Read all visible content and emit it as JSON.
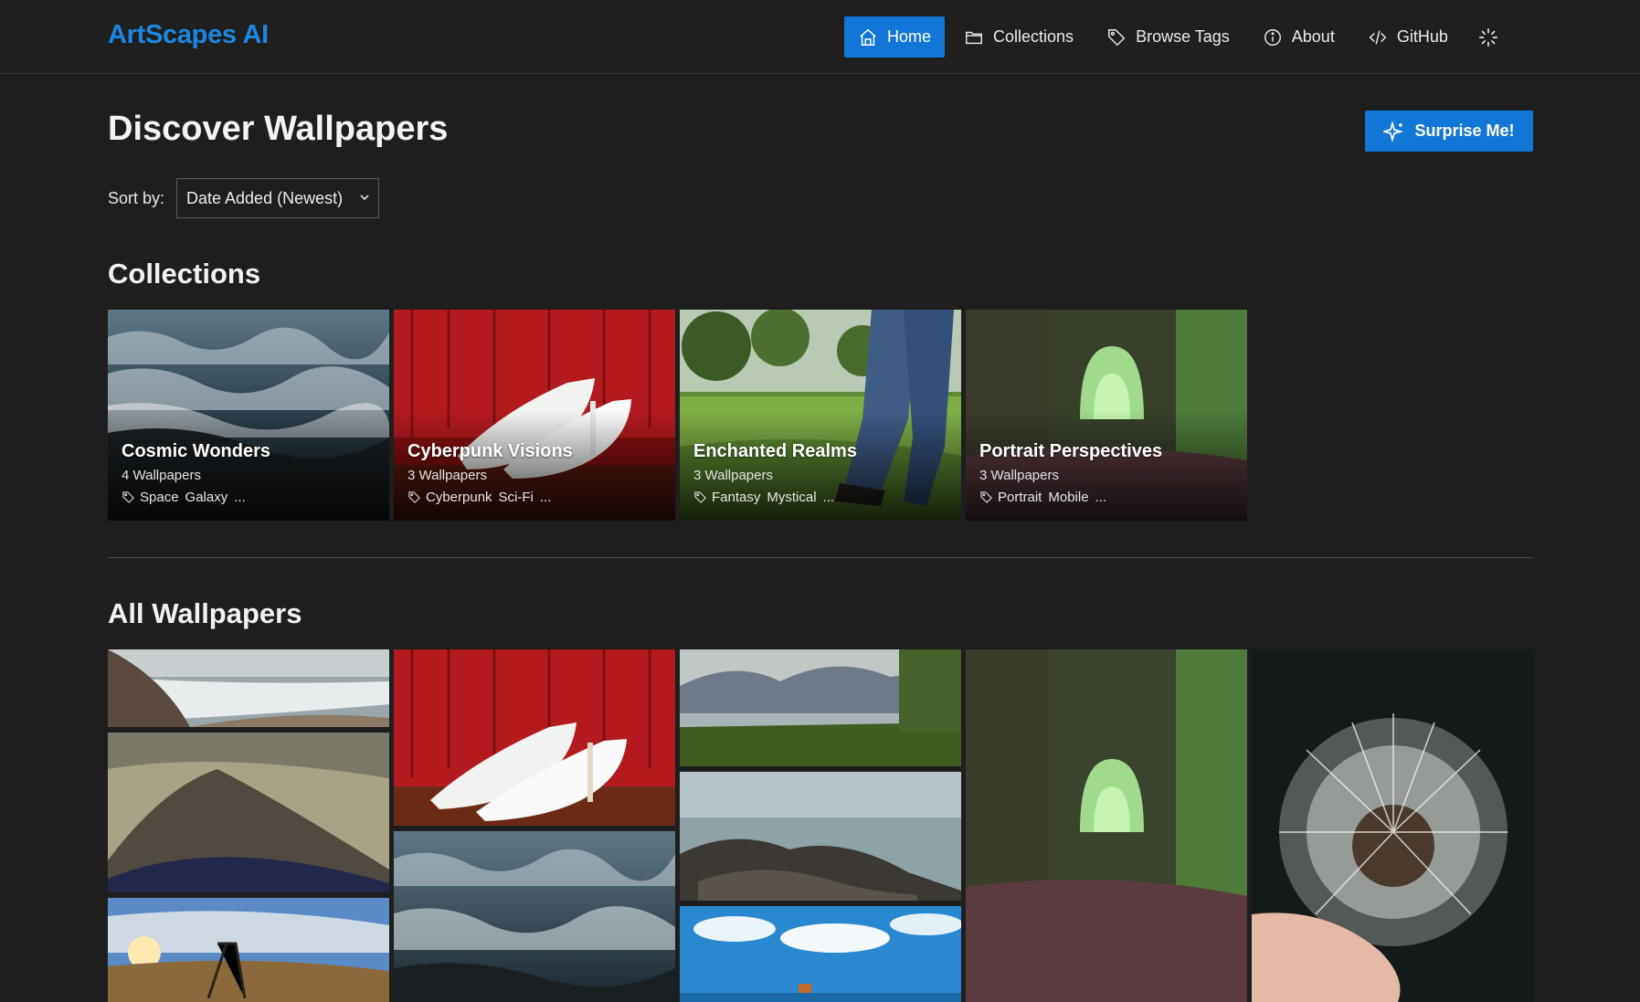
{
  "header": {
    "brand": "ArtScapes AI",
    "nav": [
      {
        "label": "Home",
        "icon": "home-icon",
        "active": true
      },
      {
        "label": "Collections",
        "icon": "folder-icon"
      },
      {
        "label": "Browse Tags",
        "icon": "tag-icon"
      },
      {
        "label": "About",
        "icon": "info-icon"
      },
      {
        "label": "GitHub",
        "icon": "code-icon"
      }
    ],
    "accent": "#1176d6"
  },
  "page": {
    "title": "Discover Wallpapers",
    "surprise_label": "Surprise Me!",
    "sort_label": "Sort by:",
    "sort_value": "Date Added (Newest)"
  },
  "collections": {
    "title": "Collections",
    "items": [
      {
        "name": "Cosmic Wonders",
        "count": "4 Wallpapers",
        "tags": [
          "Space",
          "Galaxy",
          "..."
        ]
      },
      {
        "name": "Cyberpunk Visions",
        "count": "3 Wallpapers",
        "tags": [
          "Cyberpunk",
          "Sci-Fi",
          "..."
        ]
      },
      {
        "name": "Enchanted Realms",
        "count": "3 Wallpapers",
        "tags": [
          "Fantasy",
          "Mystical",
          "..."
        ]
      },
      {
        "name": "Portrait Perspectives",
        "count": "3 Wallpapers",
        "tags": [
          "Portrait",
          "Mobile",
          "..."
        ]
      }
    ]
  },
  "wallpapers": {
    "title": "All Wallpapers"
  }
}
